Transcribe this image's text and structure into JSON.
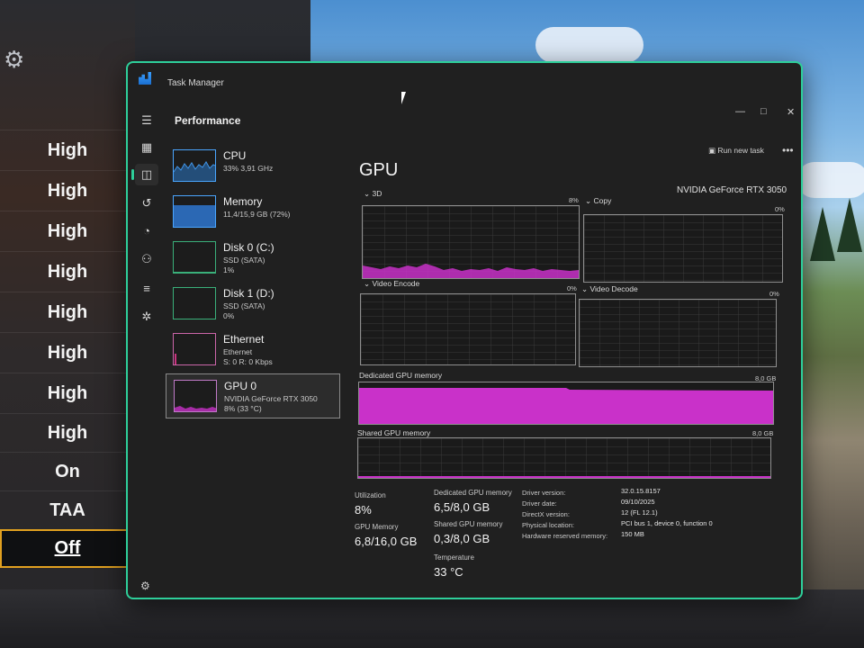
{
  "background": {
    "settings_options": [
      "High",
      "High",
      "High",
      "High",
      "High",
      "High",
      "High",
      "High",
      "On",
      "TAA",
      "Off"
    ],
    "gear_glyph": "⚙"
  },
  "window": {
    "title": "Task Manager",
    "controls": {
      "minimize": "—",
      "maximize": "□",
      "close": "✕"
    },
    "accent": "#2ecf9a",
    "section_title": "Performance",
    "run_new_task": "Run new task",
    "more": "•••"
  },
  "nav": {
    "items": [
      "hamburger-icon",
      "processes-icon",
      "performance-icon",
      "app-history-icon",
      "startup-apps-icon",
      "users-icon",
      "details-icon",
      "services-icon"
    ],
    "settings": "settings-icon"
  },
  "devices": [
    {
      "name": "CPU",
      "line1": "33%  3,91 GHz",
      "line2": ""
    },
    {
      "name": "Memory",
      "line1": "11,4/15,9 GB (72%)",
      "line2": ""
    },
    {
      "name": "Disk 0 (C:)",
      "line1": "SSD (SATA)",
      "line2": "1%"
    },
    {
      "name": "Disk 1 (D:)",
      "line1": "SSD (SATA)",
      "line2": "0%"
    },
    {
      "name": "Ethernet",
      "line1": "Ethernet",
      "line2": "S: 0  R: 0 Kbps"
    },
    {
      "name": "GPU 0",
      "line1": "NVIDIA GeForce RTX 3050",
      "line2": "8%  (33 °C)"
    }
  ],
  "gpu": {
    "title": "GPU",
    "model": "NVIDIA GeForce RTX 3050",
    "engines": [
      {
        "label": "3D",
        "pct": "8%"
      },
      {
        "label": "Copy",
        "pct": "0%"
      },
      {
        "label": "Video Encode",
        "pct": "0%"
      },
      {
        "label": "Video Decode",
        "pct": "0%"
      }
    ],
    "dedicated_label": "Dedicated GPU memory",
    "dedicated_max": "8,0 GB",
    "shared_label": "Shared GPU memory",
    "shared_max": "8,0 GB",
    "graph_color": "#c931c9",
    "stats": {
      "utilization_label": "Utilization",
      "utilization": "8%",
      "gpu_memory_label": "GPU Memory",
      "gpu_memory": "6,8/16,0 GB",
      "dedicated_label": "Dedicated GPU memory",
      "dedicated": "6,5/8,0 GB",
      "shared_label": "Shared GPU memory",
      "shared": "0,3/8,0 GB",
      "temp_label": "Temperature",
      "temp": "33 °C"
    },
    "details": [
      {
        "k": "Driver version:",
        "v": "32.0.15.8157"
      },
      {
        "k": "Driver date:",
        "v": "09/10/2025"
      },
      {
        "k": "DirectX version:",
        "v": "12 (FL 12.1)"
      },
      {
        "k": "Physical location:",
        "v": "PCI bus 1, device 0, function 0"
      },
      {
        "k": "Hardware reserved memory:",
        "v": "150 MB"
      }
    ]
  }
}
